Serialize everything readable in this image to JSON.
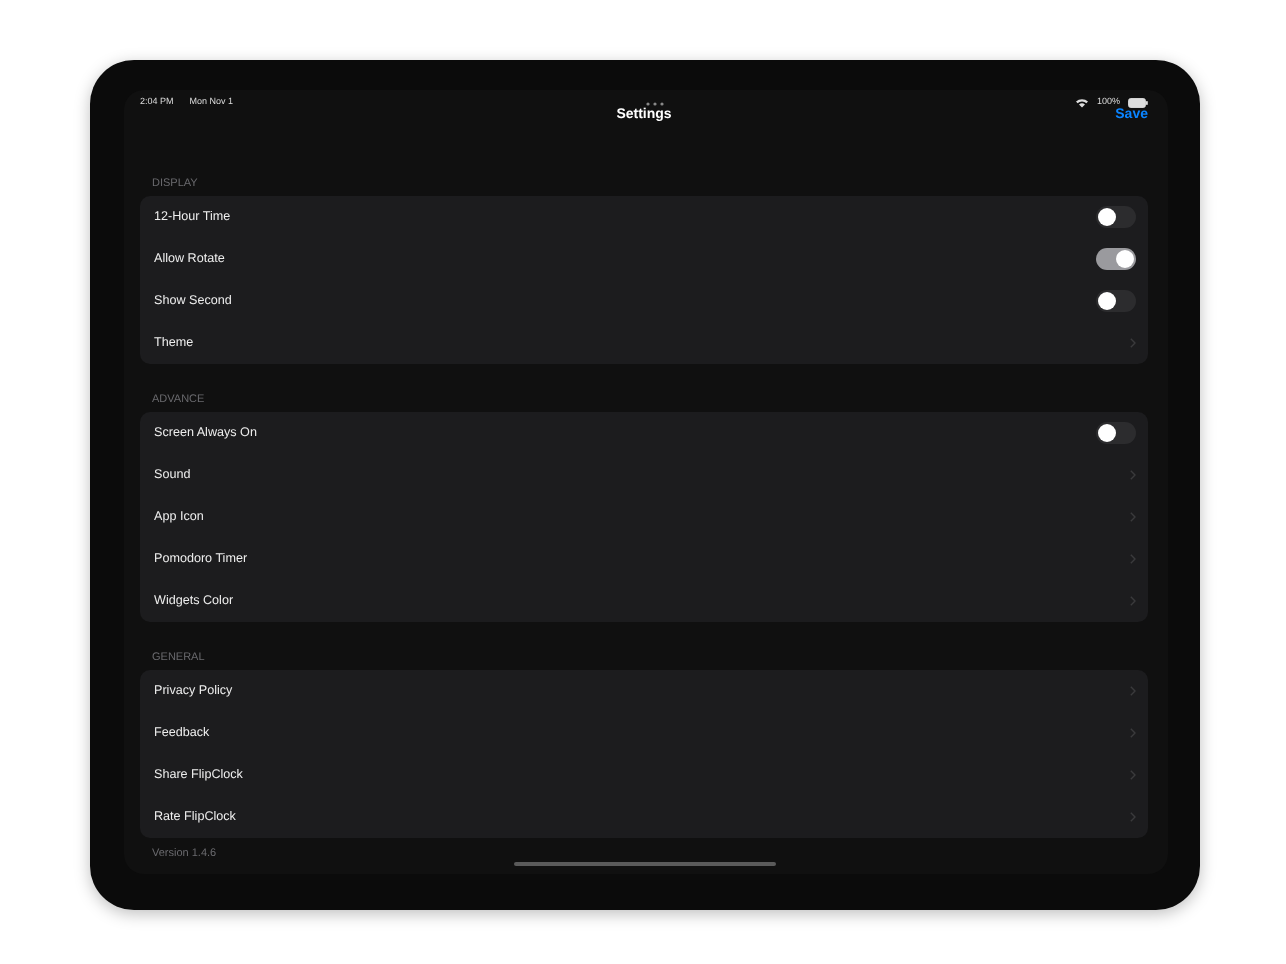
{
  "status_bar": {
    "time": "2:04 PM",
    "date": "Mon Nov 1",
    "battery": "100%"
  },
  "nav": {
    "title": "Settings",
    "action": "Save"
  },
  "sections": [
    {
      "header": "DISPLAY",
      "rows": [
        {
          "kind": "toggle",
          "label": "12-Hour Time",
          "on": false
        },
        {
          "kind": "toggle",
          "label": "Allow Rotate",
          "on": true
        },
        {
          "kind": "toggle",
          "label": "Show Second",
          "on": false
        },
        {
          "kind": "link",
          "label": "Theme"
        }
      ]
    },
    {
      "header": "ADVANCE",
      "rows": [
        {
          "kind": "toggle",
          "label": "Screen Always On",
          "on": false
        },
        {
          "kind": "link",
          "label": "Sound"
        },
        {
          "kind": "link",
          "label": "App Icon"
        },
        {
          "kind": "link",
          "label": "Pomodoro Timer"
        },
        {
          "kind": "link",
          "label": "Widgets Color"
        }
      ]
    },
    {
      "header": "GENERAL",
      "rows": [
        {
          "kind": "link",
          "label": "Privacy Policy"
        },
        {
          "kind": "link",
          "label": "Feedback"
        },
        {
          "kind": "link",
          "label": "Share FlipClock"
        },
        {
          "kind": "link",
          "label": "Rate FlipClock"
        }
      ]
    }
  ],
  "footer": "Version 1.4.6"
}
